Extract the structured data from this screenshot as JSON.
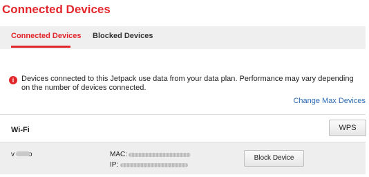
{
  "page": {
    "title": "Connected Devices"
  },
  "tabs": [
    {
      "label": "Connected Devices",
      "active": true
    },
    {
      "label": "Blocked Devices",
      "active": false
    }
  ],
  "notice": {
    "icon": "info-icon",
    "text": "Devices connected to this Jetpack use data from your data plan. Performance may vary depending on the number of devices connected."
  },
  "links": {
    "change_max": "Change Max Devices"
  },
  "wifi": {
    "title": "Wi-Fi",
    "wps_label": "WPS",
    "device": {
      "name": "v",
      "name_suffix": "o",
      "mac_label": "MAC:",
      "ip_label": "IP:",
      "block_label": "Block Device"
    }
  },
  "colors": {
    "accent": "#e2262b",
    "link": "#2a6ab2",
    "tabbar_bg": "#efefef",
    "row_bg": "#eeeeee"
  }
}
